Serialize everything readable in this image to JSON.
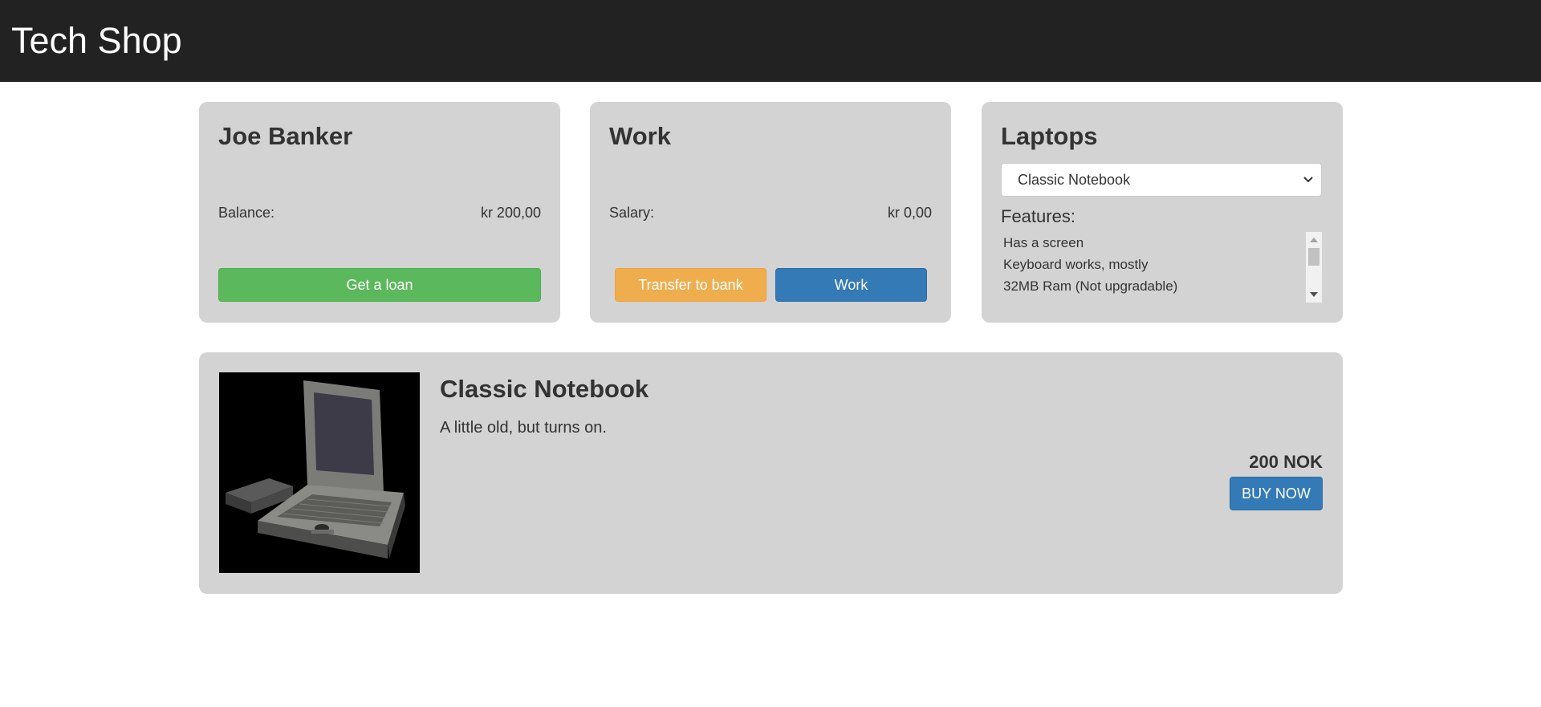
{
  "header": {
    "title": "Tech Shop"
  },
  "bank": {
    "name": "Joe Banker",
    "balance_label": "Balance:",
    "balance_value": "kr 200,00",
    "loan_button": "Get a loan"
  },
  "work": {
    "title": "Work",
    "salary_label": "Salary:",
    "salary_value": "kr 0,00",
    "transfer_button": "Transfer to bank",
    "work_button": "Work"
  },
  "laptops": {
    "title": "Laptops",
    "selected": "Classic Notebook",
    "features_title": "Features:",
    "features": [
      "Has a screen",
      "Keyboard works, mostly",
      "32MB Ram (Not upgradable)"
    ]
  },
  "product": {
    "name": "Classic Notebook",
    "description": "A little old, but turns on.",
    "price": "200 NOK",
    "buy_button": "BUY NOW",
    "image_icon": "laptop-image"
  },
  "colors": {
    "header_bg": "#222222",
    "card_bg": "#d3d3d3",
    "success": "#5cb85c",
    "warning": "#f0ad4e",
    "primary": "#337ab7"
  }
}
